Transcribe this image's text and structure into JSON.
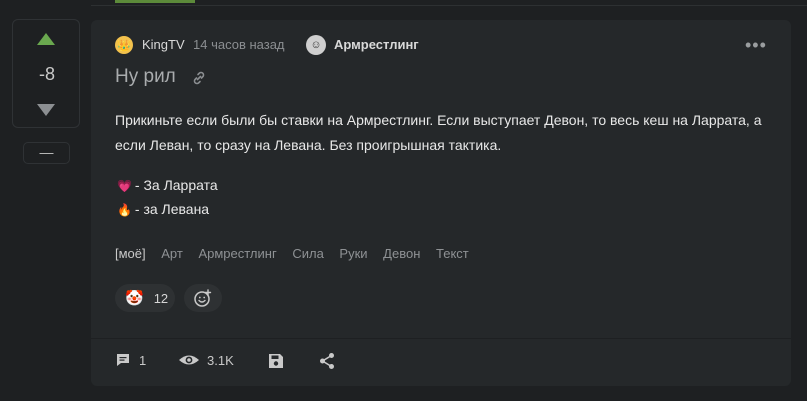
{
  "vote": {
    "score": "-8",
    "collapse_label": "—"
  },
  "post": {
    "author": "KingTV",
    "time": "14 часов назад",
    "community": "Армрестлинг",
    "title": "Ну рил",
    "body": "Прикиньте если были бы ставки на Армрестлинг. Если выступает Девон, то весь кеш на Ларрата, а если Леван, то сразу на Левана. Без проигрышная тактика.",
    "reactions_legend": [
      {
        "icon": "heart-emoji",
        "text": "- За Ларрата"
      },
      {
        "icon": "fire-emoji",
        "text": "- за Левана"
      }
    ],
    "tags": [
      "[моё]",
      "Арт",
      "Армрестлинг",
      "Сила",
      "Руки",
      "Девон",
      "Текст"
    ],
    "reaction": {
      "icon": "clown-emoji",
      "count": "12"
    }
  },
  "footer": {
    "comments_count": "1",
    "views_count": "3.1K"
  },
  "colors": {
    "background": "#1e2022",
    "card": "#25282a",
    "vote_up": "#6aa84f"
  }
}
